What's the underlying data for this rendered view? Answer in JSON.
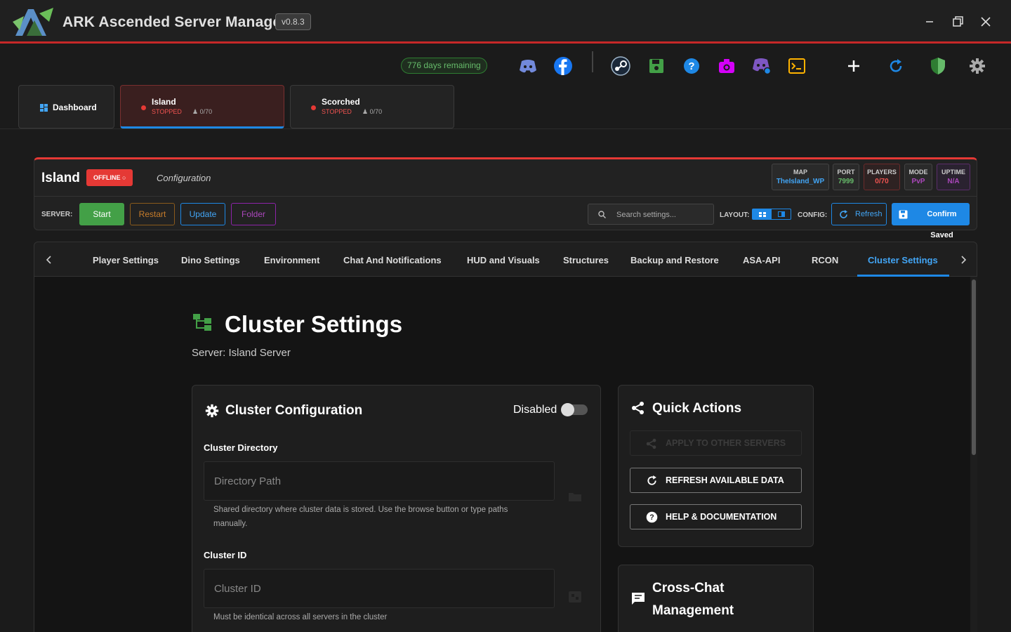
{
  "app": {
    "title": "ARK Ascended Server Manager",
    "version": "v0.8.3"
  },
  "toolbar": {
    "license_text": "776 days remaining"
  },
  "server_tabs": {
    "dashboard_label": "Dashboard",
    "servers": [
      {
        "name": "Island",
        "status": "STOPPED",
        "players": "0/70"
      },
      {
        "name": "Scorched",
        "status": "STOPPED",
        "players": "0/70"
      }
    ]
  },
  "server_panel": {
    "name": "Island",
    "status_badge": "OFFLINE",
    "subtitle": "Configuration",
    "stats": [
      {
        "key": "MAP",
        "value": "TheIsland_WP",
        "color": "#42a5f5"
      },
      {
        "key": "PORT",
        "value": "7999",
        "color": "#66bb6a"
      },
      {
        "key": "PLAYERS",
        "value": "0/70",
        "color": "#ef5350"
      },
      {
        "key": "MODE",
        "value": "PvP",
        "color": "#ab47bc"
      },
      {
        "key": "UPTIME",
        "value": "N/A",
        "color": "#ab47bc"
      }
    ],
    "server_label": "SERVER:",
    "buttons": {
      "start": "Start",
      "restart": "Restart",
      "update": "Update",
      "folder": "Folder"
    },
    "search_placeholder": "Search settings...",
    "layout_label": "LAYOUT:",
    "config_label": "CONFIG:",
    "refresh": "Refresh",
    "confirm": "Confirm Saved"
  },
  "config_tabs": [
    "Player Settings",
    "Dino Settings",
    "Environment",
    "Chat And Notifications",
    "HUD and Visuals",
    "Structures",
    "Backup and Restore",
    "ASA-API",
    "RCON",
    "Cluster Settings"
  ],
  "page": {
    "title": "Cluster Settings",
    "subtitle": "Server: Island Server"
  },
  "cluster_config": {
    "title": "Cluster Configuration",
    "toggle_label": "Disabled",
    "directory_label": "Cluster Directory",
    "directory_placeholder": "Directory Path",
    "directory_hint": "Shared directory where cluster data is stored. Use the browse button or type paths manually.",
    "id_label": "Cluster ID",
    "id_placeholder": "Cluster ID",
    "id_hint": "Must be identical across all servers in the cluster"
  },
  "quick_actions": {
    "title": "Quick Actions",
    "apply": "APPLY TO OTHER SERVERS",
    "refresh": "REFRESH AVAILABLE DATA",
    "help": "HELP & DOCUMENTATION"
  },
  "cross_chat": {
    "title_line1": "Cross-Chat",
    "title_line2": "Management"
  }
}
